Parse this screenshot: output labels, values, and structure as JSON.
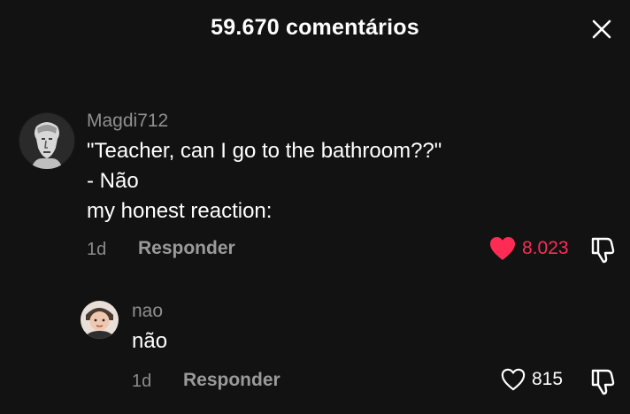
{
  "header": {
    "title": "59.670 comentários"
  },
  "comments": [
    {
      "username": "Magdi712",
      "lines": [
        "\"Teacher, can I go to the bathroom??\"",
        "- Não",
        "my honest reaction:"
      ],
      "time": "1d",
      "reply_label": "Responder",
      "likes": "8.023",
      "liked": true
    },
    {
      "username": "nao",
      "lines": [
        "não"
      ],
      "time": "1d",
      "reply_label": "Responder",
      "likes": "815",
      "liked": false
    }
  ],
  "colors": {
    "background": "#121212",
    "like_active": "#fe2c55",
    "muted": "#8f8f8f"
  }
}
